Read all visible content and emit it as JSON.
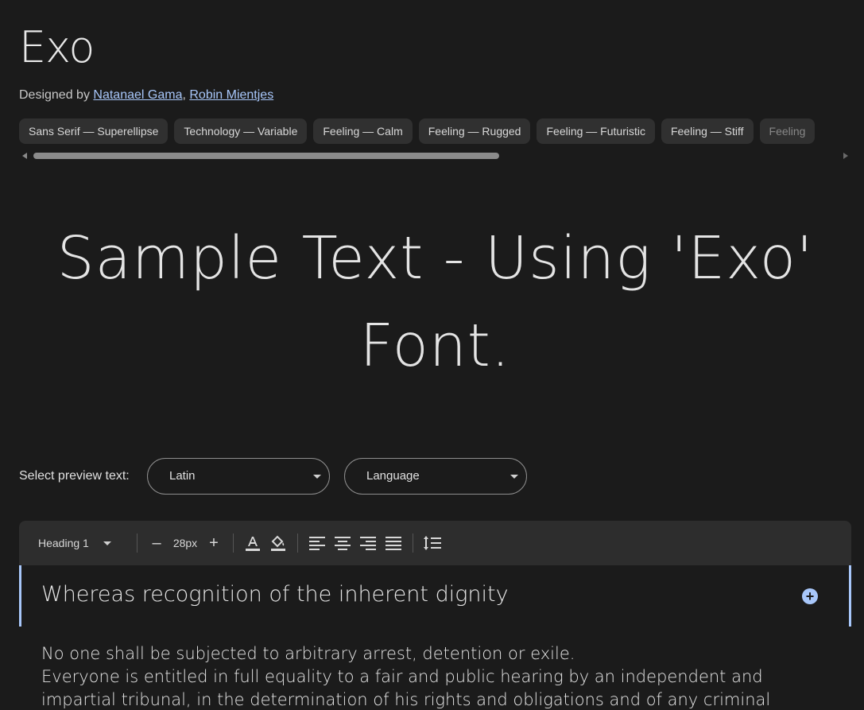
{
  "header": {
    "font_name": "Exo",
    "designed_by_label": "Designed by",
    "designers": [
      "Natanael Gama",
      "Robin Mientjes"
    ],
    "separator": ", "
  },
  "tags": [
    "Sans Serif — Superellipse",
    "Technology — Variable",
    "Feeling — Calm",
    "Feeling — Rugged",
    "Feeling — Futuristic",
    "Feeling — Stiff",
    "Feeling"
  ],
  "tags_scroll": {
    "thumb_fraction": 0.58
  },
  "sample": {
    "text": "Sample Text - Using 'Exo' Font."
  },
  "preview_controls": {
    "label": "Select preview text:",
    "script_value": "Latin",
    "language_value": "Language"
  },
  "toolbar": {
    "style_value": "Heading 1",
    "decrease_label": "–",
    "font_size": "28px",
    "increase_label": "+"
  },
  "editor": {
    "heading": "Whereas recognition of the inherent dignity",
    "paragraphs": [
      "No one shall be subjected to arbitrary arrest, detention or exile.",
      "Everyone is entitled in full equality to a fair and public hearing by an independent and",
      "impartial tribunal, in the determination of his rights and obligations and of any criminal"
    ]
  },
  "colors": {
    "background": "#1b1b1b",
    "accent": "#a8c7fa",
    "chip": "#303030",
    "toolbar": "#2d2d2d"
  }
}
